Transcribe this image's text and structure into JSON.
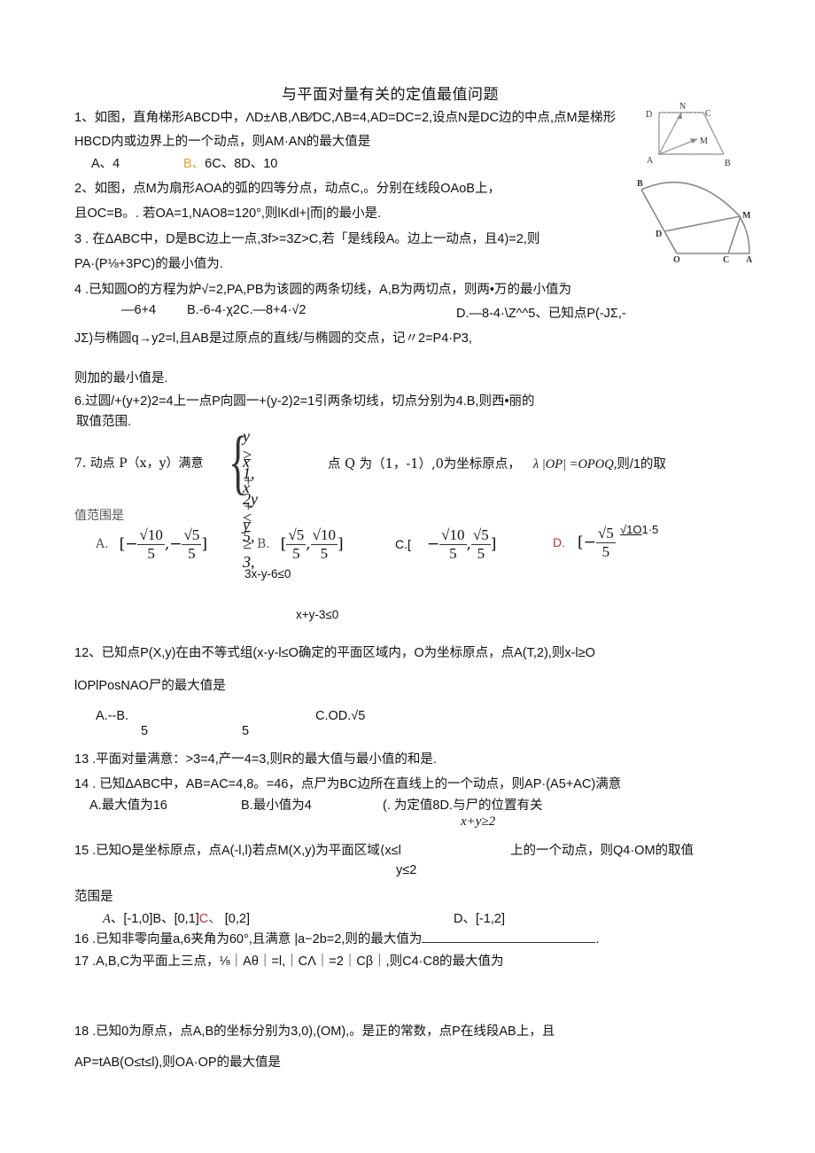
{
  "title": "与平面对量有关的定值最值问题",
  "q1": {
    "line1": "1、如图，直角梯形ABCD中，ΛD±ΛB,ΛB∕∕DC,ΛB=4,AD=DC=2,设点N是DC边的中点,点M是梯形",
    "line2": "HBCD内或边界上的一个动点，则AM·AN的最大值是",
    "optA": "A、4",
    "optB": "B、",
    "optRest": "6C、8D、10",
    "figure": {
      "labels": [
        "D",
        "N",
        "C",
        "M",
        "A",
        "B"
      ]
    }
  },
  "q2": {
    "line1": "2、如图，点M为扇形AOA的弧的四等分点，动点C,。分别在线段OAoB上，",
    "line2": "且OC=B。. 若OA=1,NAO8=120°,则lKdl+|而|的最小是.",
    "figure": {
      "labels": [
        "B",
        "M",
        "D",
        "O",
        "C",
        "A"
      ]
    }
  },
  "q3": {
    "line1": "3   . 在ΔABC中，D是BC边上一点,3f>=3Z>C,若「是线段A。边上一动点，且4)=2,则",
    "line2": "PA·(P⅛+3PC)的最小值为."
  },
  "q4": {
    "line1": "4   .已知圆O的方程为炉√=2,PA,PB为该圆的两条切线，A,B为两切点，则两•万的最小值为",
    "optA": "—6+4",
    "optB": "B.-6-4·χ2C.—8+4·√2",
    "optD": "D.—8-4·\\Z^^5、已知点P(-JΣ,-",
    "line3": "JΣ)与椭圆q→y2=l,且AB是过原点的直线/与椭圆的交点，记〃2=P4·P3,",
    "line4": "则加的最小值是."
  },
  "q6": {
    "line1": "6.过圆/+(y+2)2=4上一点P向圆一+(y-2)2=1引两条切线，切点分别为4.B,则西•丽的",
    "line2": "取值范围."
  },
  "q7": {
    "prefix": "7.  动点 P（x，y）满意",
    "system": [
      "y ≥ 1,",
      "x + 2y ≤ 5,",
      "x + y ≥ 3,"
    ],
    "suffix": "点 Q 为（1，-1）,0为坐标原点，",
    "suffix2": "λ |OP| =OPOQ,",
    "suffix3": "则/1的取",
    "line2": "值范围是",
    "optA_label": "A.",
    "optA": {
      "open": "[−",
      "n1": "√10",
      "d1": "5",
      "sep": ",−",
      "n2": "√5",
      "d2": "5",
      "close": "]"
    },
    "optB_label": "B.",
    "optB": {
      "open": "[",
      "n1": "√5",
      "d1": "5",
      "sep": ",",
      "n2": "√10",
      "d2": "5",
      "close": "]"
    },
    "optC_label": "C.[",
    "optC": {
      "open": "−",
      "n1": "√10",
      "d1": "5",
      "sep": ",",
      "n2": "√5",
      "d2": "5",
      "close": "]"
    },
    "optD_label": "D.",
    "optD": {
      "open": "[−",
      "n1": "√5",
      "d1": "5",
      "tail": "√1O",
      "tail2": "1·5"
    }
  },
  "q12": {
    "ineq1": "3x-y-6≤0",
    "ineq2": "x+y-3≤0",
    "line1": "12、已知点P(X,y)在由不等式组(x-y-l≤O确定的平面区域内，O为坐标原点，点A(T,2),则x-l≥O",
    "line2": "lOPlPosNAO尸的最大值是",
    "optsTop": "A.--B.",
    "optsRight": "C.OD.√5",
    "den1": "5",
    "den2": "5"
  },
  "q13": {
    "line1": "13   .平面对量满意：>3=4,产一4=3,则R的最大值与最小值的和是."
  },
  "q14": {
    "line1": "14   . 已知ΔABC中，AB=AC=4,8。=46，点尸为BC边所在直线上的一个动点，则AP·(A5+AC)满意",
    "optA": "A.最大值为16",
    "optB": "B.最小值为4",
    "optCD": "(. 为定值8D.与尸的位置有关"
  },
  "q15": {
    "ineqTop": "x+y≥2",
    "line1": "15   .已知O是坐标原点，点A(-l,l)若点M(X,y)为平面区域⟨x≤l",
    "line1b": "上的一个动点，则Q4·OM的取值",
    "ineqBottom": "y≤2",
    "line2": "范围是",
    "optA_label": "A",
    "optA": "、[-1,0]B、[0,1]",
    "optC": "C、",
    "optC_val": "[0,2]",
    "optD": "D、[-1,2]"
  },
  "q16": {
    "line1": "16   .已知非零向量a,6夹角为60°,且满意 |a−2b=2,则的最大值为",
    "end": "."
  },
  "q17": {
    "line1": "17   .A,B,C为平面上三点，⅛｜Aθ｜=l,｜CΛ｜=2｜Cβ｜,则C4·C8的最大值为"
  },
  "q18": {
    "line1": "18   .已知0为原点，点A,B的坐标分别为3,0),(OM),。是正的常数，点P在线段AB上，且",
    "line2": "AP=tAB(O≤t≤l),则OA·OP的最大值是"
  },
  "colors": {
    "answer_orange": "#e8a030",
    "answer_red": "#c0303a"
  }
}
